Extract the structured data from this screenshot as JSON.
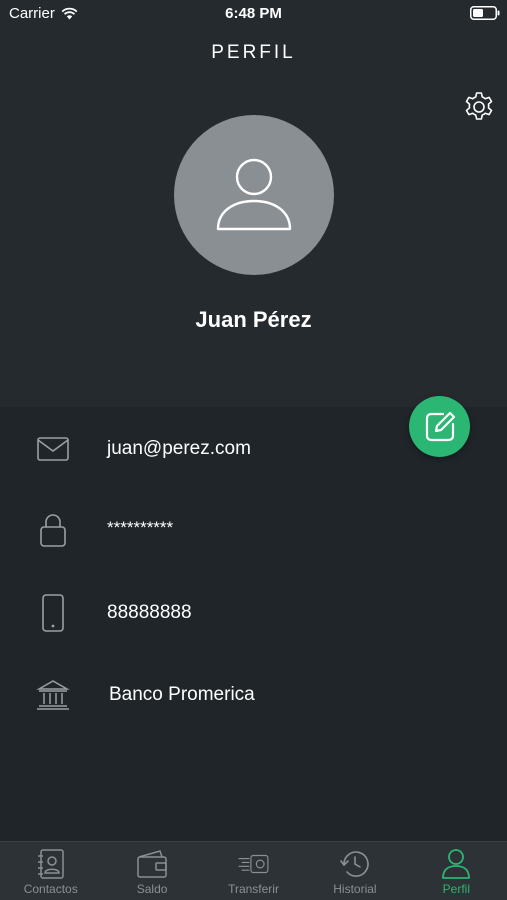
{
  "status_bar": {
    "carrier": "Carrier",
    "time": "6:48 PM"
  },
  "header": {
    "title": "PERFIL",
    "settings_icon": "gear-icon"
  },
  "profile": {
    "name": "Juan Pérez",
    "avatar_icon": "user-icon"
  },
  "info": [
    {
      "icon": "envelope-icon",
      "value": "juan@perez.com"
    },
    {
      "icon": "lock-icon",
      "value": "**********"
    },
    {
      "icon": "phone-icon",
      "value": "88888888"
    },
    {
      "icon": "bank-icon",
      "value": "Banco Promerica"
    }
  ],
  "edit_icon": "edit-icon",
  "tabs": [
    {
      "label": "Contactos",
      "icon": "contacts-icon",
      "active": false
    },
    {
      "label": "Saldo",
      "icon": "wallet-icon",
      "active": false
    },
    {
      "label": "Transferir",
      "icon": "transfer-icon",
      "active": false
    },
    {
      "label": "Historial",
      "icon": "history-icon",
      "active": false
    },
    {
      "label": "Perfil",
      "icon": "profile-icon",
      "active": true
    }
  ],
  "colors": {
    "background": "#242a2e",
    "panel": "#1f2529",
    "accent": "#2bb673",
    "avatar": "#8a8f93",
    "tab_inactive": "#8b9094"
  }
}
